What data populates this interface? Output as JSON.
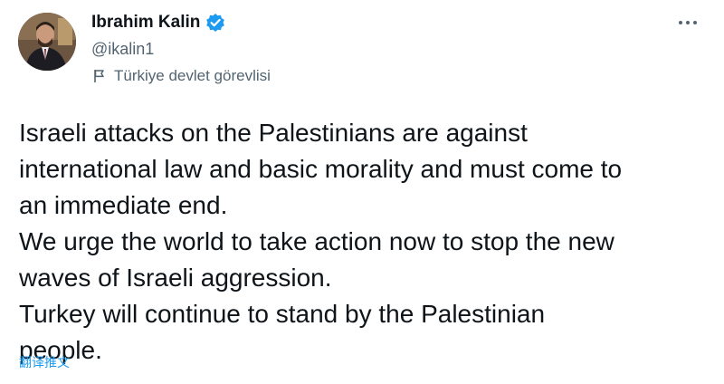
{
  "author": {
    "display_name": "Ibrahim Kalin",
    "handle": "@ikalin1",
    "affiliation_label": "Türkiye devlet görevlisi",
    "verified": true,
    "verified_color": "#1d9bf0"
  },
  "tweet": {
    "lines": [
      "Israeli attacks on the Palestinians are against",
      "international law and basic morality and must come to",
      "an immediate end.",
      "We urge the world to take action now to stop the new",
      "waves of Israeli aggression.",
      "Turkey will continue to stand by the Palestinian",
      "people."
    ]
  },
  "actions": {
    "translate_label": "翻译推文",
    "more_icon": "more-horizontal-icon"
  },
  "colors": {
    "text_primary": "#0f1419",
    "text_secondary": "#536471",
    "link": "#1d9bf0"
  }
}
